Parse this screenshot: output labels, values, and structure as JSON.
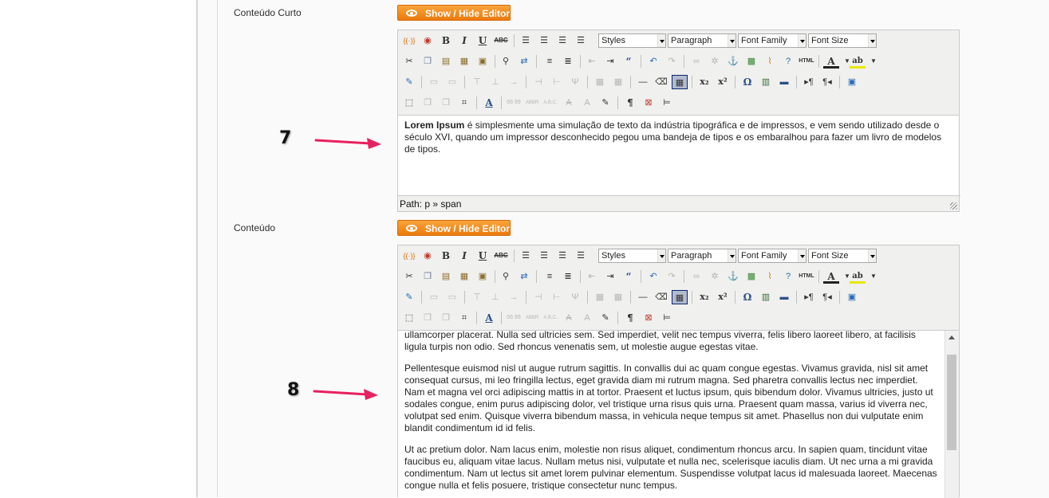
{
  "fields": [
    {
      "label": "Conteúdo Curto",
      "toggle_label": "Show / Hide Editor",
      "selects": {
        "styles": "Styles",
        "format": "Paragraph",
        "font_family": "Font Family",
        "font_size": "Font Size"
      },
      "content": {
        "bold_lead": "Lorem Ipsum",
        "text": " é simplesmente uma simulação de texto da indústria tipográfica e de impressos, e vem sendo utilizado desde o século XVI, quando um impressor desconhecido pegou uma bandeja de tipos e os embaralhou para fazer um livro de modelos de tipos."
      },
      "path": "Path: p » span",
      "annotation": "7"
    },
    {
      "label": "Conteúdo",
      "toggle_label": "Show / Hide Editor",
      "selects": {
        "styles": "Styles",
        "format": "Paragraph",
        "font_family": "Font Family",
        "font_size": "Font Size"
      },
      "paragraphs": [
        "ullamcorper placerat. Nulla sed ultricies sem. Sed imperdiet, velit nec tempus viverra, felis libero laoreet libero, at facilisis ligula turpis non odio. Sed rhoncus venenatis sem, ut molestie augue egestas vitae.",
        "Pellentesque euismod nisl ut augue rutrum sagittis. In convallis dui ac quam congue egestas. Vivamus gravida, nisl sit amet consequat cursus, mi leo fringilla lectus, eget gravida diam mi rutrum magna. Sed pharetra convallis lectus nec imperdiet. Nam et magna vel orci adipiscing mattis in at tortor. Praesent et luctus ipsum, quis bibendum dolor. Vivamus ultricies, justo ut sodales congue, enim purus adipiscing dolor, vel tristique urna risus quis urna. Praesent quam massa, varius id viverra nec, volutpat sed enim. Quisque viverra bibendum massa, in vehicula neque tempus sit amet. Phasellus non dui vulputate enim blandit condimentum id id felis.",
        "Ut ac pretium dolor. Nam lacus enim, molestie non risus aliquet, condimentum rhoncus arcu. In sapien quam, tincidunt vitae faucibus eu, aliquam vitae lacus. Nullam metus nisi, vulputate et nulla nec, scelerisque iaculis diam. Ut nec urna a mi gravida condimentum. Nam ut lectus sit amet lorem pulvinar elementum. Suspendisse volutpat lacus id malesuada laoreet. Maecenas congue nulla et felis posuere, tristique consectetur nunc tempus."
      ],
      "annotation": "8"
    }
  ],
  "toolbar_icons": {
    "row1": [
      "source-code-icon",
      "spellcheck-icon",
      "bold-icon",
      "italic-icon",
      "underline-icon",
      "strikethrough-icon",
      "align-left-icon",
      "align-center-icon",
      "align-right-icon",
      "align-justify-icon"
    ],
    "row1_glyphs": {
      "source": "{(·)}",
      "bold": "B",
      "italic": "I",
      "underline": "U",
      "strike": "ABC"
    },
    "row2": [
      "cut-icon",
      "copy-icon",
      "paste-icon",
      "paste-text-icon",
      "paste-word-icon",
      "find-icon",
      "replace-icon",
      "bullet-list-icon",
      "numbered-list-icon",
      "outdent-icon",
      "indent-icon",
      "blockquote-icon",
      "undo-icon",
      "redo-icon",
      "link-icon",
      "unlink-icon",
      "anchor-icon",
      "image-icon",
      "cleanup-icon",
      "help-icon",
      "html-icon",
      "text-color-icon",
      "highlight-color-icon"
    ],
    "row2_glyphs": {
      "html": "HTML",
      "text_color": "A",
      "highlight": "ab"
    },
    "row3": [
      "edit-icon",
      "table-row-icon",
      "table-col-icon",
      "insert-row-before-icon",
      "insert-row-after-icon",
      "delete-row-icon",
      "insert-col-before-icon",
      "insert-col-after-icon",
      "delete-col-icon",
      "split-cells-icon",
      "merge-cells-icon",
      "horizontal-rule-icon",
      "remove-format-icon",
      "visual-aid-icon",
      "subscript-icon",
      "superscript-icon",
      "special-char-icon",
      "media-icon",
      "advanced-hr-icon",
      "ltr-icon",
      "rtl-icon",
      "fullscreen-icon"
    ],
    "row3_glyphs": {
      "sub": "x₂",
      "sup": "x²",
      "omega": "Ω"
    },
    "row4": [
      "insert-layer-icon",
      "move-forward-icon",
      "move-backward-icon",
      "absolute-icon",
      "style-props-icon",
      "cite-icon",
      "abbr-icon",
      "acronym-icon",
      "del-icon",
      "ins-icon",
      "attribs-icon",
      "show-blocks-icon",
      "nonbreaking-icon",
      "page-break-icon"
    ],
    "row4_glyphs": {
      "cite": "66 99",
      "abbr": "ABBR",
      "acronym": "A.B.C.",
      "pilcrow": "¶"
    }
  },
  "colors": {
    "accent_orange": "#f08c1e",
    "arrow_pink": "#e8215f"
  }
}
